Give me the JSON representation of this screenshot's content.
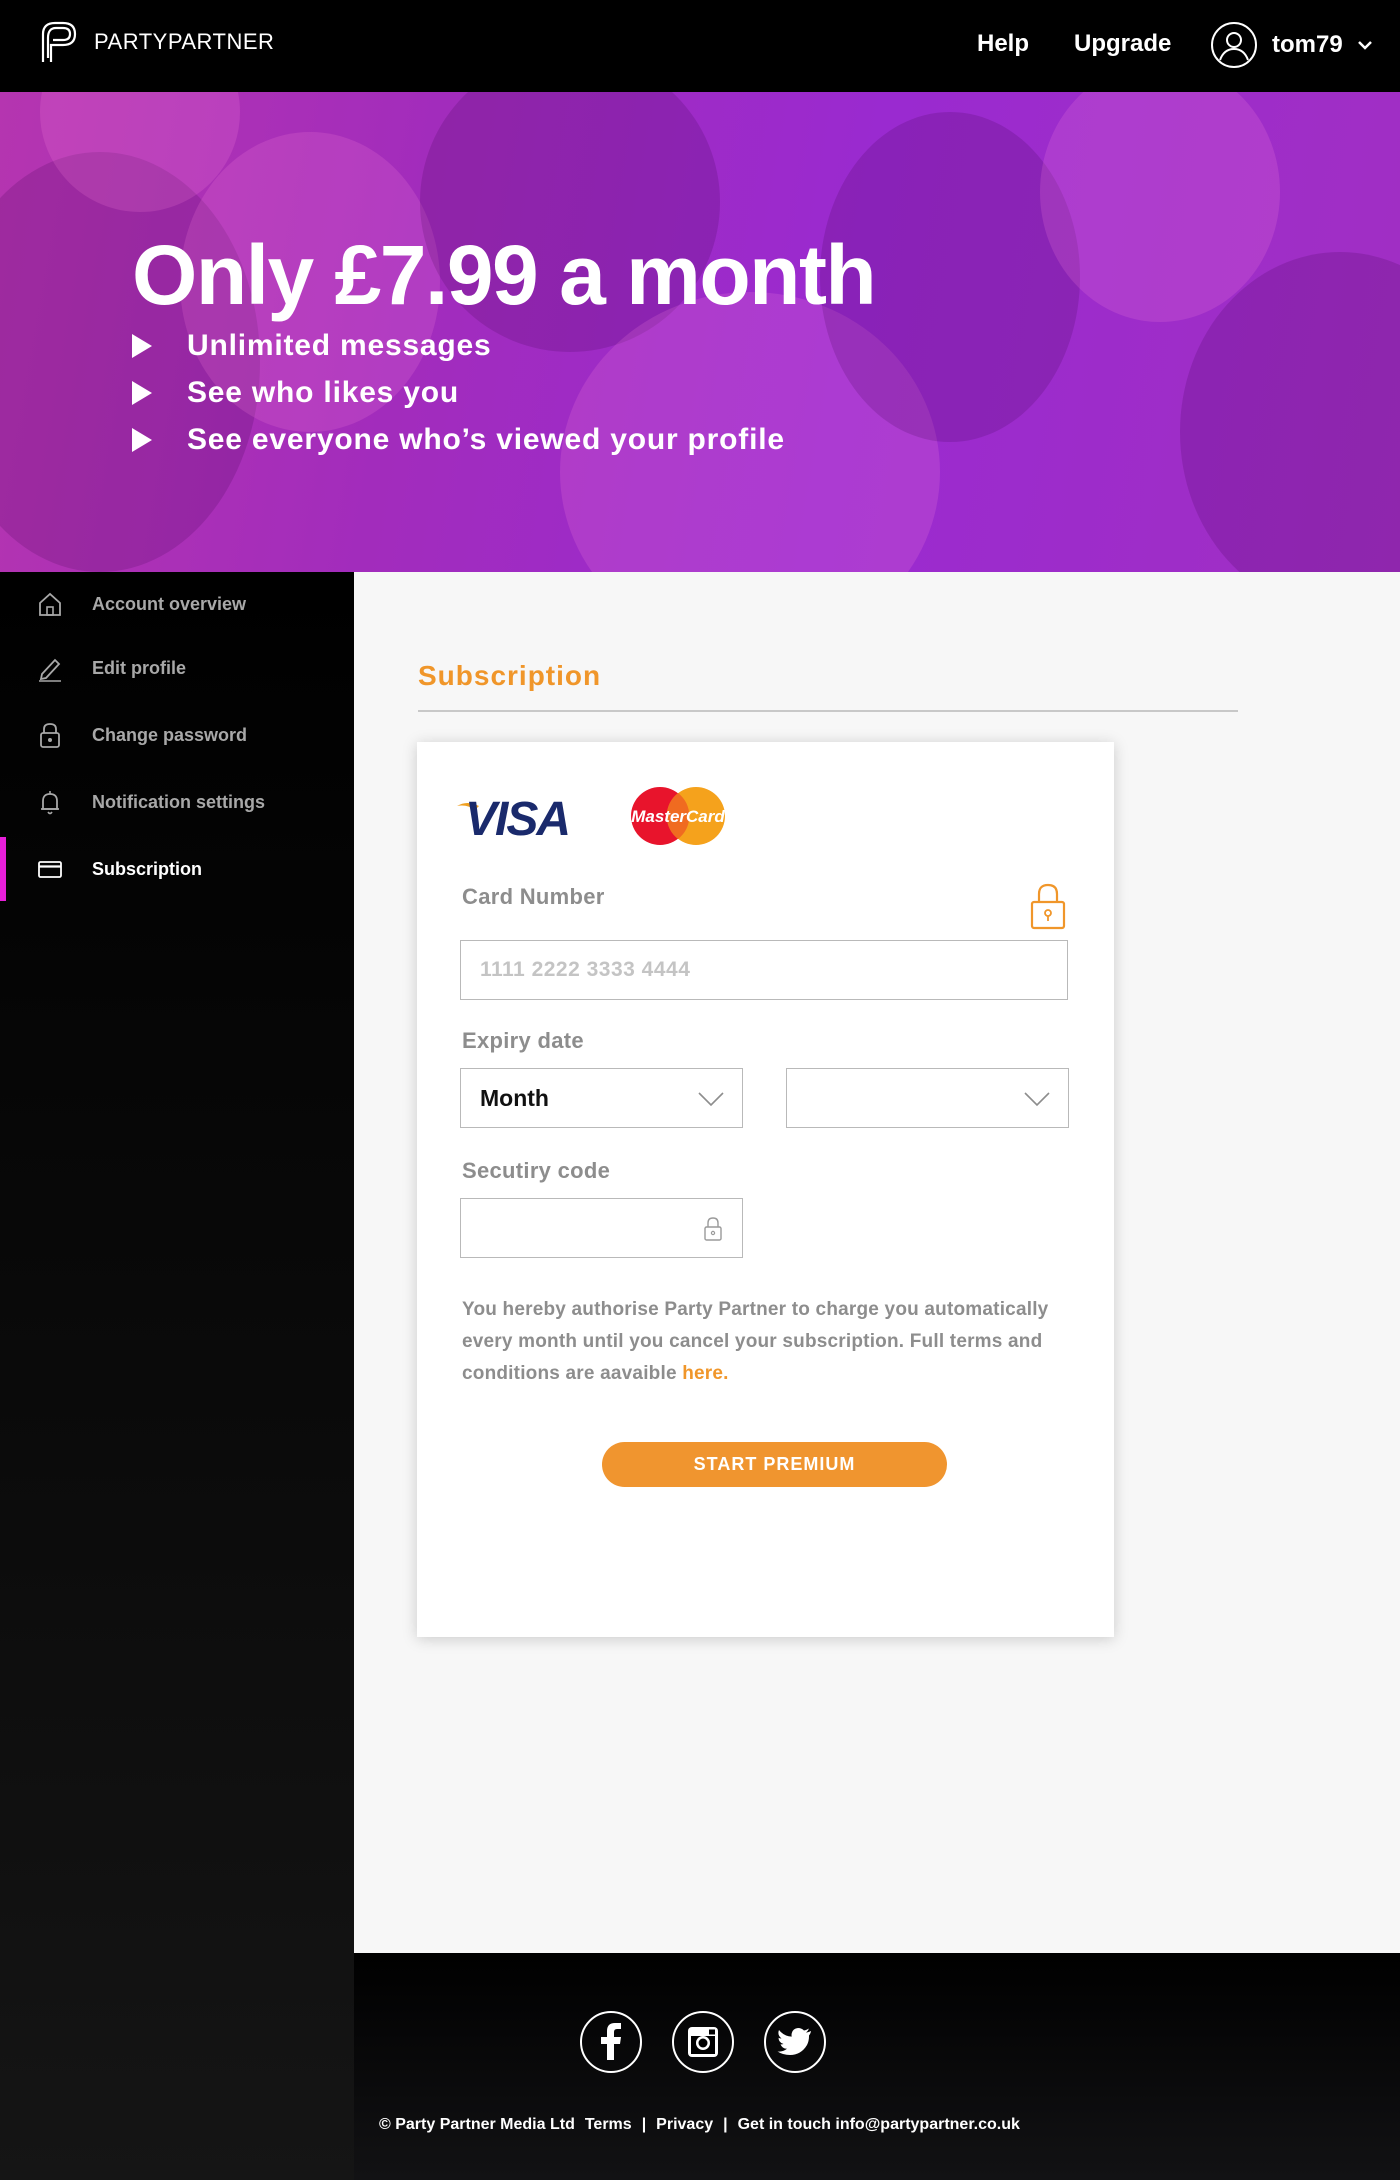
{
  "header": {
    "logo_text": "PARTYPARTNER",
    "nav": {
      "help": "Help",
      "upgrade": "Upgrade"
    },
    "username": "tom79"
  },
  "hero": {
    "title": "Only £7.99 a month",
    "benefits": [
      "Unlimited messages",
      "See who likes you",
      "See everyone who’s viewed your profile"
    ]
  },
  "sidebar": {
    "items": [
      {
        "label": "Account overview",
        "icon": "home-icon"
      },
      {
        "label": "Edit profile",
        "icon": "pencil-icon"
      },
      {
        "label": "Change password",
        "icon": "lock-icon"
      },
      {
        "label": "Notification settings",
        "icon": "bell-icon"
      },
      {
        "label": "Subscription",
        "icon": "credit-card-icon",
        "active": true
      }
    ]
  },
  "main": {
    "section_title": "Subscription",
    "form": {
      "card_number_label": "Card Number",
      "card_number_placeholder": "1111 2222 3333 4444",
      "expiry_label": "Expiry date",
      "month_value": "Month",
      "year_value": "",
      "security_label": "Secutiry code",
      "terms_text": "You hereby authorise Party Partner to charge you automatically every month until you cancel your subscription. Full terms and conditions are aavaible ",
      "terms_link": "here.",
      "submit_label": "START PREMIUM"
    },
    "card_logos": {
      "visa": "VISA",
      "mastercard": "MasterCard"
    }
  },
  "footer": {
    "copyright": "© Party Partner Media Ltd",
    "terms": "Terms",
    "privacy": "Privacy",
    "contact_label": "Get in touch",
    "email": "info@partypartner.co.uk",
    "separator": "|",
    "social": [
      "facebook-icon",
      "instagram-icon",
      "twitter-icon"
    ]
  },
  "colors": {
    "accent": "#f0962a",
    "active_marker": "#e81fd9",
    "hero": "#9a2ad0"
  }
}
